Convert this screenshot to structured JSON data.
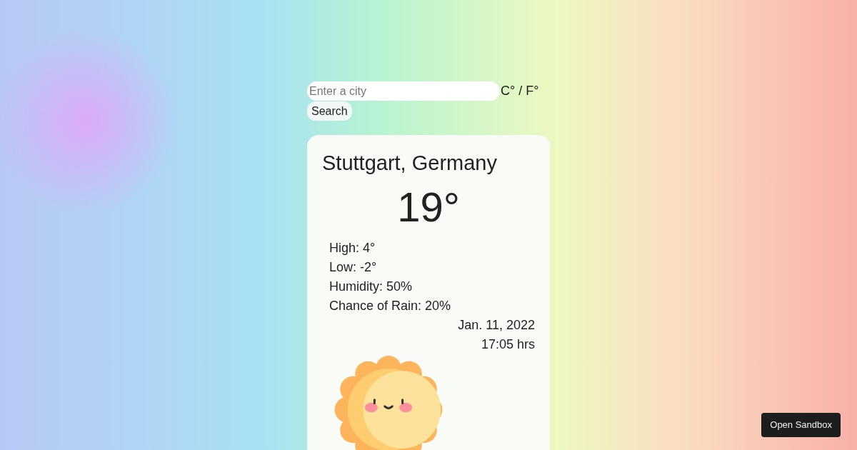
{
  "search": {
    "placeholder": "Enter a city",
    "unit_toggle": "C° / F°",
    "button": "Search"
  },
  "weather": {
    "city": "Stuttgart, Germany",
    "temperature": "19°",
    "details": [
      "High: 4°",
      "Low: -2°",
      "Humidity: 50%",
      "Chance of Rain: 20%"
    ],
    "date": "Jan. 11, 2022",
    "time": "17:05 hrs"
  },
  "sandbox_button": "Open Sandbox"
}
